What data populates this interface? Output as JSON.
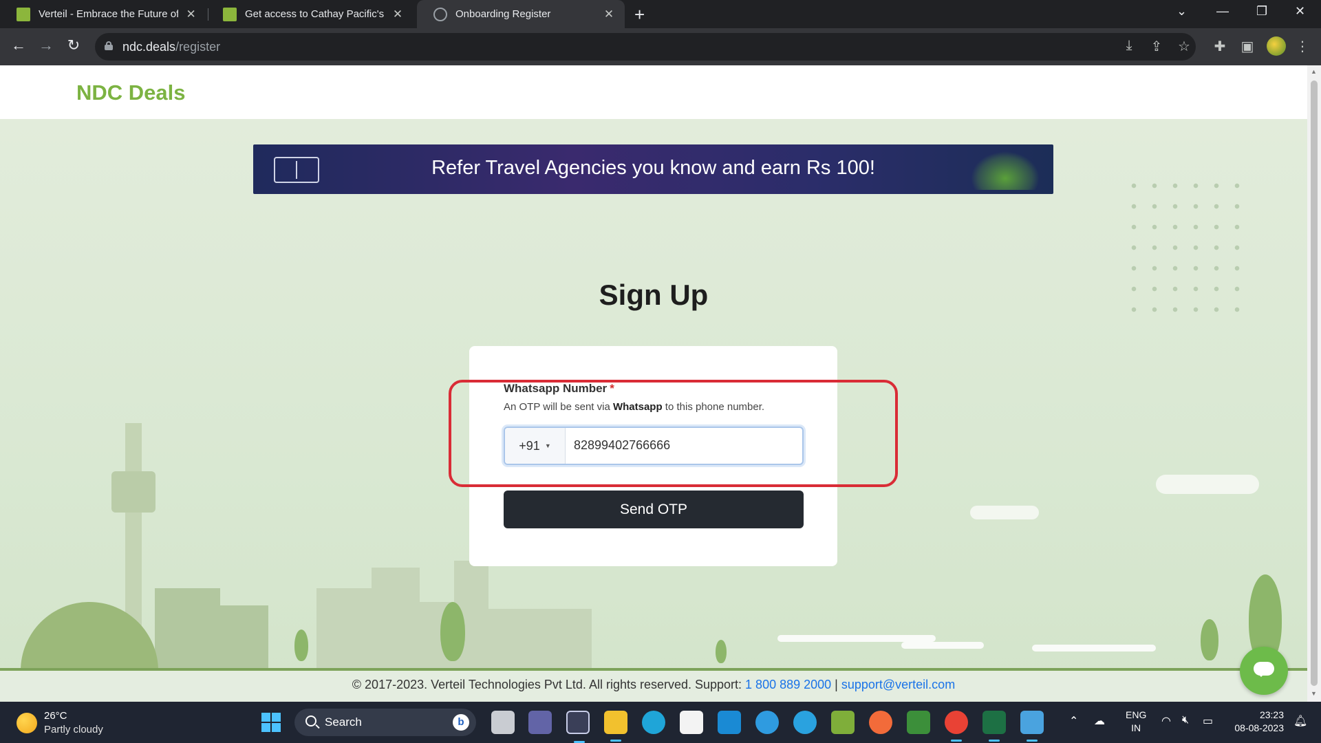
{
  "browser": {
    "tabs": [
      {
        "title": "Verteil - Embrace the Future of D",
        "active": false,
        "favicon": "green-logo"
      },
      {
        "title": "Get access to Cathay Pacific's ND",
        "active": false,
        "favicon": "green-logo"
      },
      {
        "title": "Onboarding Register",
        "active": true,
        "favicon": "globe-icon"
      }
    ],
    "url_domain": "ndc.deals",
    "url_path": "/register"
  },
  "site": {
    "brand": "NDC Deals",
    "brand_color": "#7cb342",
    "banner_text": "Refer Travel Agencies you know and earn Rs 100!"
  },
  "form": {
    "heading": "Sign Up",
    "field_label": "Whatsapp Number",
    "required_mark": "*",
    "hint_prefix": "An OTP will be sent via ",
    "hint_bold": "Whatsapp",
    "hint_suffix": " to this phone number.",
    "country_code": "+91",
    "phone_value": "82899402766666",
    "submit_label": "Send OTP",
    "highlight_color": "#d92c36"
  },
  "footer": {
    "text": "© 2017-2023. Verteil Technologies Pvt Ltd. All rights reserved. Support: ",
    "phone": "1 800 889 2000",
    "separator": " | ",
    "email": "support@verteil.com"
  },
  "taskbar": {
    "weather_temp": "26°C",
    "weather_cond": "Partly cloudy",
    "search_label": "Search",
    "lang_line1": "ENG",
    "lang_line2": "IN",
    "time": "23:23",
    "date": "08-08-2023"
  }
}
